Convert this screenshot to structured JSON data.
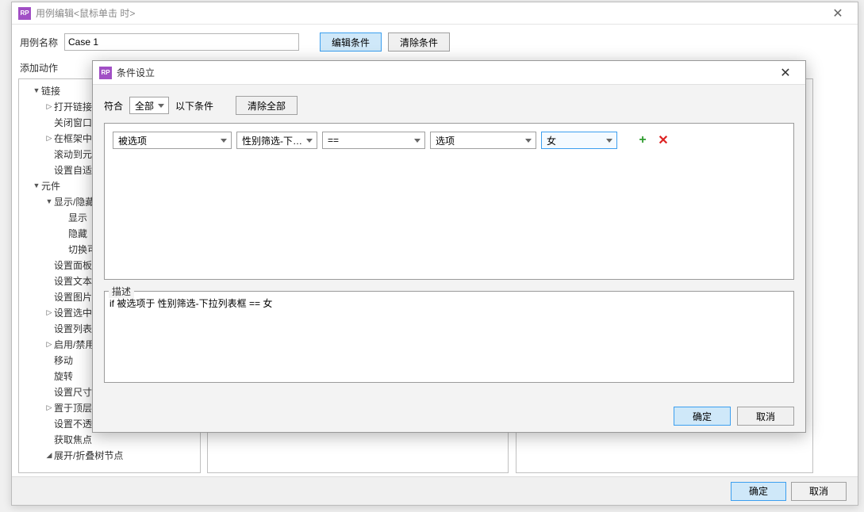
{
  "main": {
    "title": "用例编辑<鼠标单击 时>",
    "icon": "RP",
    "case_label": "用例名称",
    "case_value": "Case 1",
    "edit_condition": "编辑条件",
    "clear_condition": "清除条件",
    "add_action": "添加动作",
    "ok": "确定",
    "cancel": "取消"
  },
  "tree": [
    {
      "label": "链接",
      "indent": 0,
      "arrow": "▼"
    },
    {
      "label": "打开链接",
      "indent": 1,
      "arrow": "▷"
    },
    {
      "label": "关闭窗口",
      "indent": 1,
      "arrow": ""
    },
    {
      "label": "在框架中打开链接",
      "indent": 1,
      "arrow": "▷"
    },
    {
      "label": "滚动到元件<锚链接>",
      "indent": 1,
      "arrow": ""
    },
    {
      "label": "设置自适应视图",
      "indent": 1,
      "arrow": ""
    },
    {
      "label": "元件",
      "indent": 0,
      "arrow": "▼"
    },
    {
      "label": "显示/隐藏",
      "indent": 1,
      "arrow": "▼"
    },
    {
      "label": "显示",
      "indent": 2,
      "arrow": ""
    },
    {
      "label": "隐藏",
      "indent": 2,
      "arrow": ""
    },
    {
      "label": "切换可见性",
      "indent": 2,
      "arrow": ""
    },
    {
      "label": "设置面板状态",
      "indent": 1,
      "arrow": ""
    },
    {
      "label": "设置文本",
      "indent": 1,
      "arrow": ""
    },
    {
      "label": "设置图片",
      "indent": 1,
      "arrow": ""
    },
    {
      "label": "设置选中",
      "indent": 1,
      "arrow": "▷"
    },
    {
      "label": "设置列表选中项",
      "indent": 1,
      "arrow": ""
    },
    {
      "label": "启用/禁用",
      "indent": 1,
      "arrow": "▷"
    },
    {
      "label": "移动",
      "indent": 1,
      "arrow": ""
    },
    {
      "label": "旋转",
      "indent": 1,
      "arrow": ""
    },
    {
      "label": "设置尺寸",
      "indent": 1,
      "arrow": ""
    },
    {
      "label": "置于顶层/底层",
      "indent": 1,
      "arrow": "▷"
    },
    {
      "label": "设置不透明",
      "indent": 1,
      "arrow": ""
    },
    {
      "label": "获取焦点",
      "indent": 1,
      "arrow": ""
    },
    {
      "label": "展开/折叠树节点",
      "indent": 1,
      "arrow": "◢"
    }
  ],
  "cond": {
    "title": "条件设立",
    "icon": "RP",
    "match": "符合",
    "match_value": "全部",
    "match_suffix": "以下条件",
    "clear_all": "清除全部",
    "row": {
      "c1": "被选项",
      "c2": "性别筛选-下拉列表",
      "c3": "==",
      "c4": "选项",
      "c5": "女"
    },
    "desc_label": "描述",
    "desc_value": "if 被选项于 性别筛选-下拉列表框 == 女",
    "ok": "确定",
    "cancel": "取消"
  }
}
